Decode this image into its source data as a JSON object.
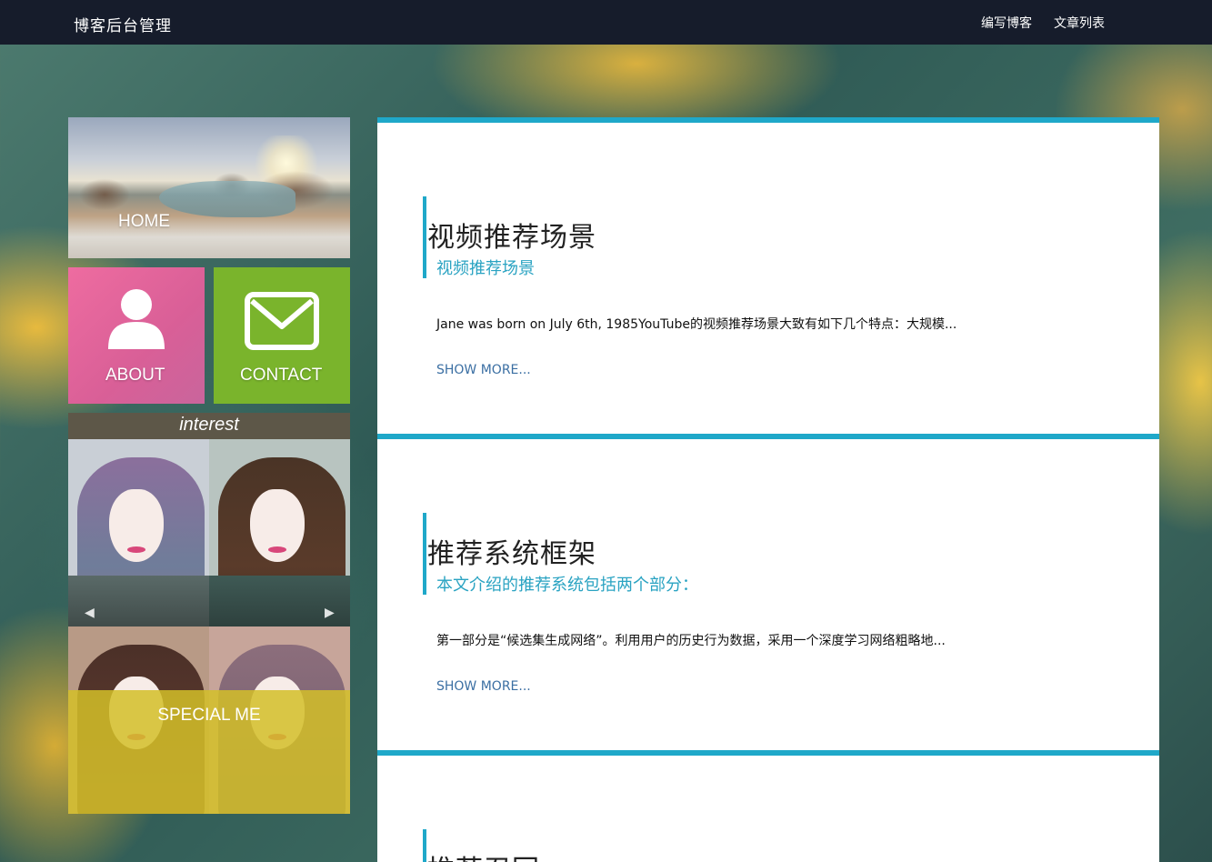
{
  "navbar": {
    "brand": "博客后台管理",
    "links": [
      {
        "label": "编写博客"
      },
      {
        "label": "文章列表"
      }
    ]
  },
  "sidebar": {
    "home_label": "HOME",
    "about_label": "ABOUT",
    "contact_label": "CONTACT",
    "interest_title": "interest",
    "special_label": "SPECIAL ME"
  },
  "posts": [
    {
      "title": "视频推荐场景",
      "subtitle": "视频推荐场景",
      "excerpt": "Jane was born on July 6th, 1985YouTube的视频推荐场景大致有如下几个特点：大规模...",
      "more": "SHOW MORE..."
    },
    {
      "title": "推荐系统框架",
      "subtitle": "本文介绍的推荐系统包括两个部分：",
      "excerpt": "第一部分是“候选集生成网络”。利用用户的历史行为数据，采用一个深度学习网络粗略地...",
      "more": "SHOW MORE..."
    },
    {
      "title": "推荐召回",
      "subtitle": "",
      "excerpt": "",
      "more": ""
    }
  ],
  "colors": {
    "navbar_bg": "#161c2b",
    "accent": "#1fa8c9",
    "about_tile": "#e2659b",
    "contact_tile": "#7ab42c",
    "special_overlay": "#d4c028",
    "link": "#3b6fa3"
  },
  "icons": {
    "about": "user-icon",
    "contact": "envelope-icon",
    "carousel_prev": "chevron-left-icon",
    "carousel_next": "chevron-right-icon"
  }
}
